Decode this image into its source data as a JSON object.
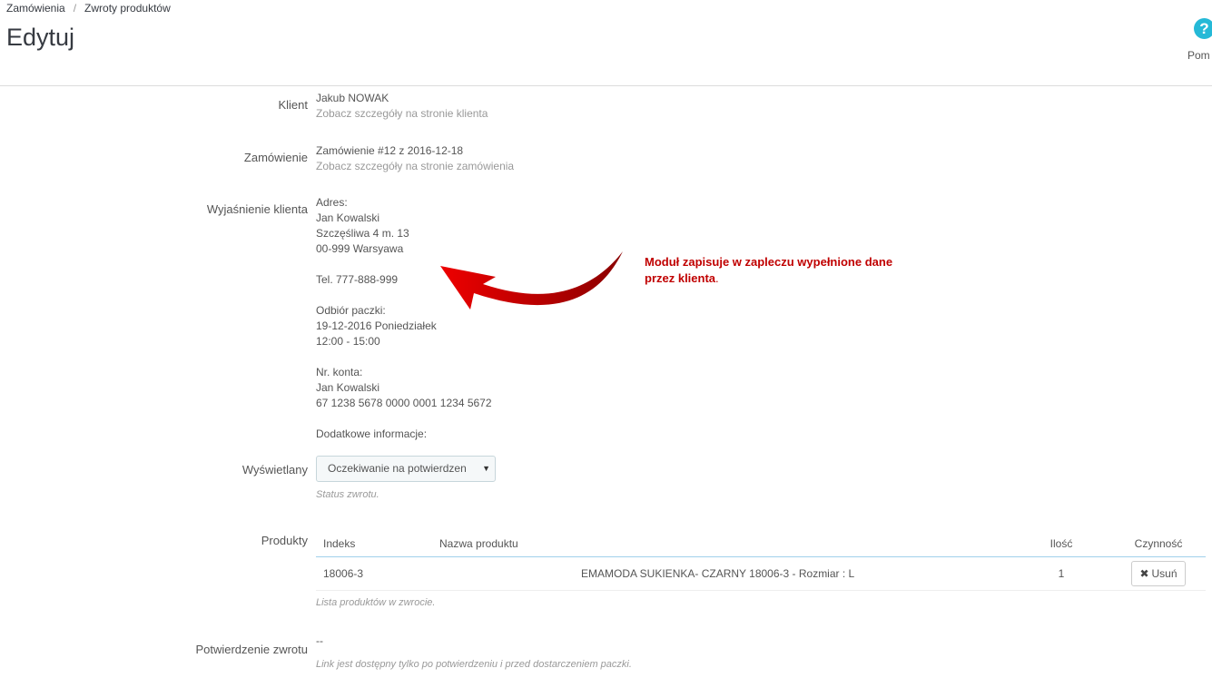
{
  "breadcrumb": {
    "items": [
      "Zamówienia",
      "Zwroty produktów"
    ],
    "separator": "/"
  },
  "page_title": "Edytuj",
  "help": {
    "icon": "?",
    "label": "Pom"
  },
  "fields": {
    "client": {
      "label": "Klient",
      "value": "Jakub NOWAK",
      "link": "Zobacz szczegóły na stronie klienta"
    },
    "order": {
      "label": "Zamówienie",
      "value": "Zamówienie #12 z 2016-12-18",
      "link": "Zobacz szczegóły na stronie zamówienia"
    },
    "explanation": {
      "label": "Wyjaśnienie klienta",
      "lines": [
        "Adres:",
        "Jan Kowalski",
        "Szczęśliwa 4 m. 13",
        "00-999 Warsyawa",
        "",
        "Tel. 777-888-999",
        "",
        "Odbiór paczki:",
        "19-12-2016 Poniedziałek",
        "12:00 - 15:00",
        "",
        "Nr. konta:",
        "Jan Kowalski",
        "67 1238 5678 0000 0001 1234 5672",
        "",
        "Dodatkowe informacje:"
      ]
    },
    "status": {
      "label": "Wyświetlany",
      "selected": "Oczekiwanie na potwierdzen",
      "help": "Status zwrotu."
    },
    "products": {
      "label": "Produkty",
      "columns": [
        "Indeks",
        "Nazwa produktu",
        "Ilość",
        "Czynność"
      ],
      "rows": [
        {
          "index": "18006-3",
          "name": "EMAMODA SUKIENKA- CZARNY 18006-3 - Rozmiar : L",
          "qty": "1",
          "action": "Usuń"
        }
      ],
      "help": "Lista produktów w zwrocie."
    },
    "confirmation": {
      "label": "Potwierdzenie zwrotu",
      "value": "--",
      "help": "Link jest dostępny tylko po potwierdzeniu i przed dostarczeniem paczki."
    }
  },
  "annotation": {
    "text": "Moduł zapisuje w zapleczu wypełnione dane przez klienta",
    "period": ".",
    "color": "#c00000"
  },
  "colors": {
    "accent": "#25b9d7",
    "annotation": "#c00000",
    "table_header_border": "#a0d0eb"
  },
  "icons": {
    "help": "question-circle-icon",
    "delete": "times-icon",
    "select": "caret-down-icon",
    "arrow": "curved-arrow-icon"
  }
}
